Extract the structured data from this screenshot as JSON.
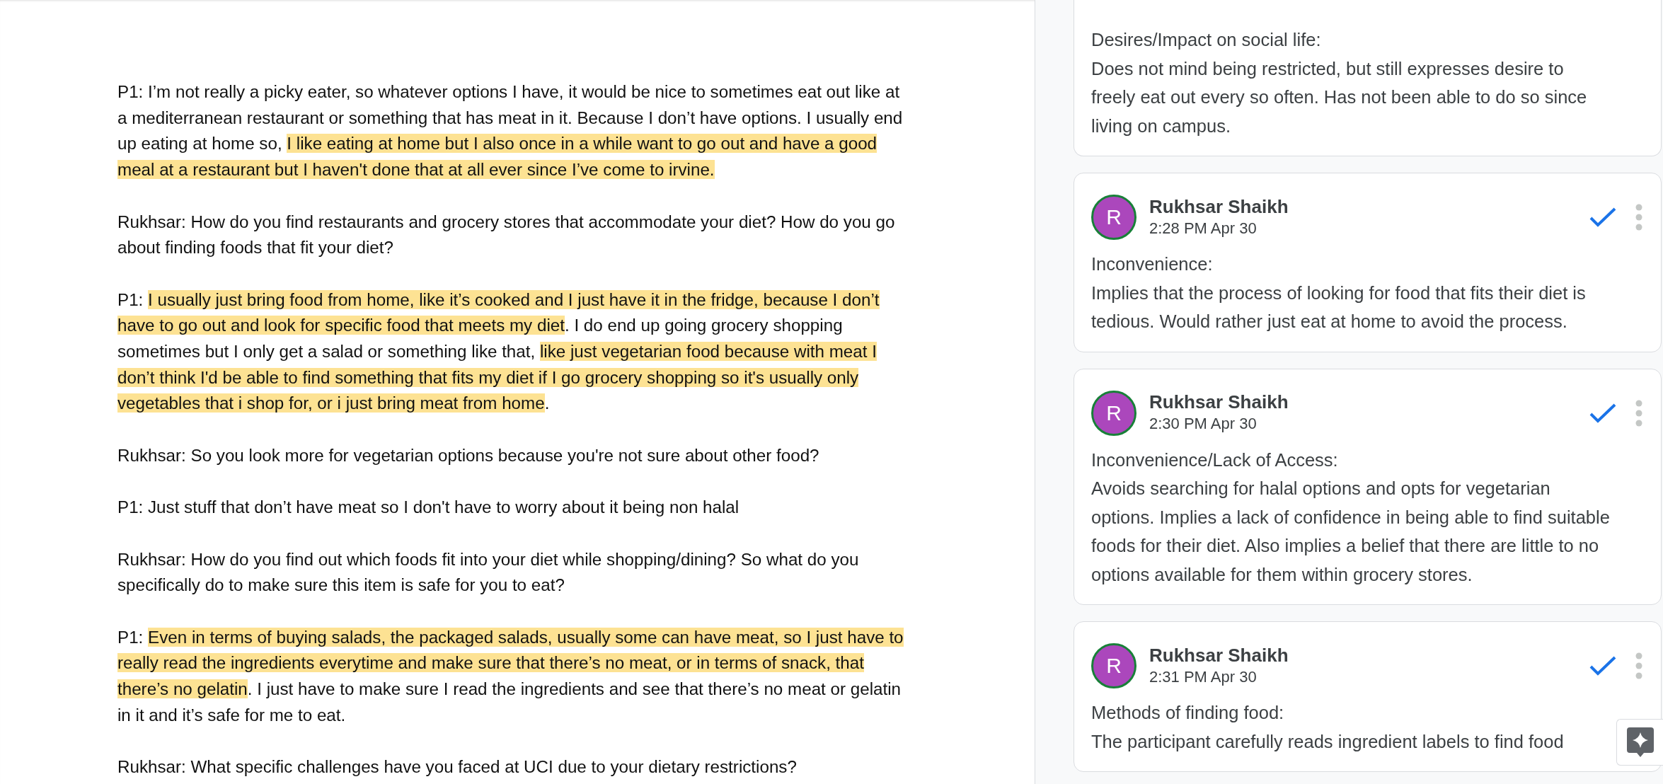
{
  "transcript": [
    {
      "segments": [
        {
          "text": "P1: I’m not really a picky eater, so whatever options I have, it would be nice to sometimes eat out like at a mediterranean restaurant or something that has meat in it. Because I don’t have options. I usually end up eating at home so, ",
          "highlighted": false
        },
        {
          "text": "I like eating at home but I also once in a while want to go out and have a good meal at a restaurant but I haven't done that at all ever since I’ve come to irvine.",
          "highlighted": true
        }
      ]
    },
    {
      "segments": [
        {
          "text": "Rukhsar: How do you find restaurants and grocery stores that accommodate your diet? How do you go about finding foods that fit your diet?",
          "highlighted": false
        }
      ]
    },
    {
      "segments": [
        {
          "text": "P1: ",
          "highlighted": false
        },
        {
          "text": "I usually just bring food from home, like it’s cooked and I just have it in the fridge, because I don’t have to go out and look for specific food that meets my diet",
          "highlighted": true
        },
        {
          "text": ". I do end up going grocery shopping sometimes but I only get a salad or something like that, ",
          "highlighted": false
        },
        {
          "text": "like just vegetarian food because with meat I don’t think I'd be able to find something that fits my diet if I go grocery shopping so it's usually only vegetables that i shop for, or i just bring meat from home",
          "highlighted": true
        },
        {
          "text": ".",
          "highlighted": false
        }
      ]
    },
    {
      "segments": [
        {
          "text": "Rukhsar: So you look more for vegetarian options because you're not sure about other food?",
          "highlighted": false
        }
      ]
    },
    {
      "segments": [
        {
          "text": "P1: Just stuff that don’t have meat so I don't have to worry about it being non halal",
          "highlighted": false
        }
      ]
    },
    {
      "segments": [
        {
          "text": "Rukhsar: How do you find out which foods fit into your diet while shopping/dining? So what do you specifically do to make sure this item is safe for you to eat?",
          "highlighted": false
        }
      ]
    },
    {
      "segments": [
        {
          "text": "P1: ",
          "highlighted": false
        },
        {
          "text": "Even in terms of buying salads, the packaged salads, usually some can have meat, so I just have to really read the ingredients everytime and make sure that there’s no meat, or in terms of snack, that there’s no gelatin",
          "highlighted": true
        },
        {
          "text": ". I just have to make sure I read the ingredients and see that there’s no meat or gelatin in it and it’s safe for me to eat.",
          "highlighted": false
        }
      ]
    },
    {
      "segments": [
        {
          "text": "Rukhsar: What specific challenges have you faced at UCI due to your dietary restrictions?",
          "highlighted": false
        }
      ]
    }
  ],
  "comments": [
    {
      "heading": "Desires/Impact on social life:",
      "body": "Does not mind being restricted, but still expresses desire to freely eat out every so often. Has not been able to do so since living on campus."
    },
    {
      "avatar": "R",
      "author": "Rukhsar Shaikh",
      "time": "2:28 PM Apr 30",
      "heading": "Inconvenience:",
      "body": "Implies that the process of looking for food that fits their diet is tedious. Would rather just eat at home to avoid the process."
    },
    {
      "avatar": "R",
      "author": "Rukhsar Shaikh",
      "time": "2:30 PM Apr 30",
      "heading": "Inconvenience/Lack of Access:",
      "body": "Avoids searching for halal options and opts for vegetarian options. Implies a lack of confidence in being able to find suitable foods for their diet. Also implies a belief that there are little to no options available for them within grocery stores."
    },
    {
      "avatar": "R",
      "author": "Rukhsar Shaikh",
      "time": "2:31 PM Apr 30",
      "heading": "Methods of finding food:",
      "body": "The participant carefully reads ingredient labels to find food"
    }
  ]
}
